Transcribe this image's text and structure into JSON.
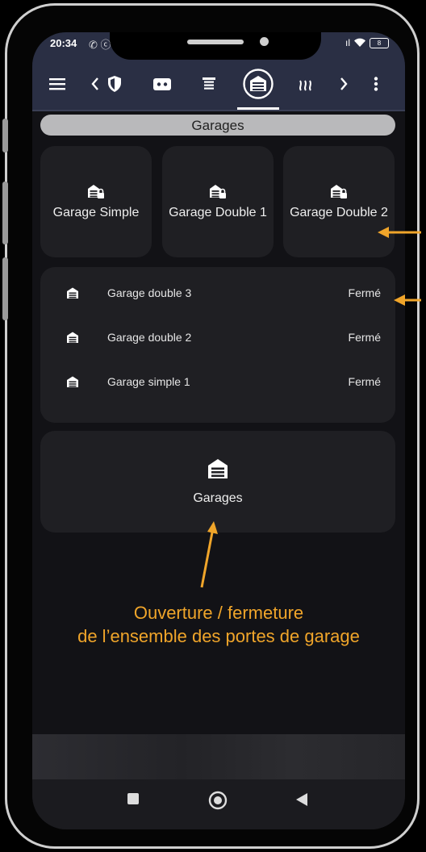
{
  "status": {
    "time": "20:34",
    "misc": "✆ ⓒ",
    "signal": "ıl",
    "battery": "8"
  },
  "toolbar": {
    "items": [
      "menu-icon",
      "chevron-left-icon",
      "shield-icon",
      "robot-icon",
      "server-icon",
      "garage-icon",
      "heating-icon",
      "chevron-right-icon",
      "more-vert-icon"
    ],
    "active": "garage-icon"
  },
  "section": {
    "title": "Garages"
  },
  "tiles": [
    {
      "label": "Garage Simple"
    },
    {
      "label": "Garage Double 1"
    },
    {
      "label": "Garage Double 2"
    }
  ],
  "list": [
    {
      "name": "Garage double 3",
      "state": "Fermé"
    },
    {
      "name": "Garage double 2",
      "state": "Fermé"
    },
    {
      "name": "Garage simple 1",
      "state": "Fermé"
    }
  ],
  "group": {
    "label": "Garages"
  },
  "annotation": {
    "line1": "Ouverture / fermeture",
    "line2": "de l’ensemble des portes de garage",
    "color": "#f0a52a"
  },
  "navbar": {
    "buttons": [
      "stop-icon",
      "home-circle-icon",
      "back-triangle-icon"
    ]
  }
}
